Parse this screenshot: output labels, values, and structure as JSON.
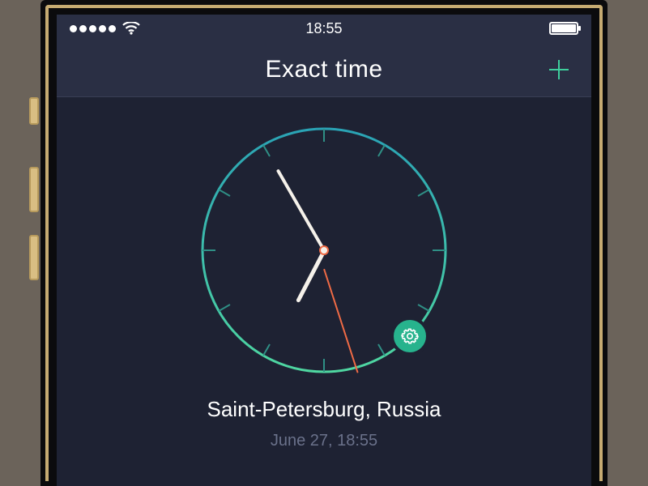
{
  "statusbar": {
    "time": "18:55"
  },
  "header": {
    "title": "Exact time"
  },
  "clock": {
    "hour": 18,
    "minute": 55,
    "second": 27,
    "settings_position_deg": 135,
    "ring_gradient_start": "#2aa3b5",
    "ring_gradient_end": "#4fd7a1",
    "tick_color": "#2f8f85"
  },
  "location": {
    "name": "Saint-Petersburg, Russia",
    "subtitle": "June 27, 18:55"
  },
  "colors": {
    "accent": "#3ecf9d",
    "second_hand": "#ef6a45",
    "background": "#1e2233",
    "header_bg": "#2a2f44"
  }
}
